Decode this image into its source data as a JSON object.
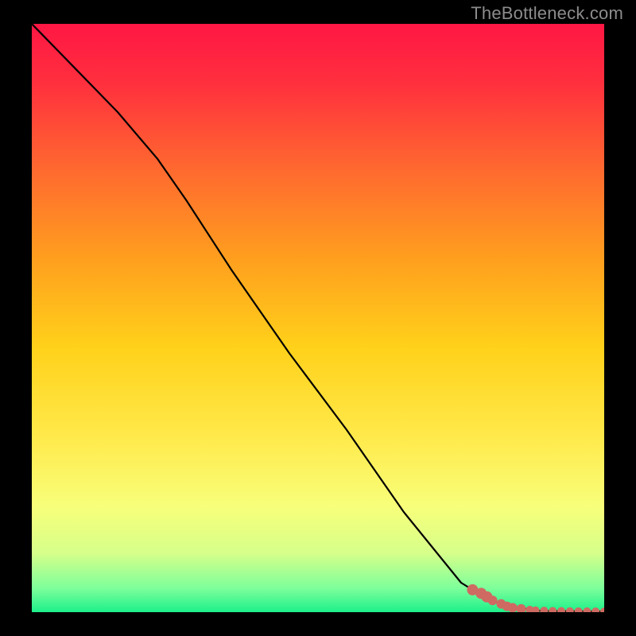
{
  "attribution": "TheBottleneck.com",
  "colors": {
    "background": "#000000",
    "attribution_text": "#8c8c8c",
    "line": "#000000",
    "marker": "#cf6a62",
    "gradient_stops": [
      {
        "offset": "0%",
        "color": "#ff1744"
      },
      {
        "offset": "10%",
        "color": "#ff2f3e"
      },
      {
        "offset": "25%",
        "color": "#ff6a2f"
      },
      {
        "offset": "40%",
        "color": "#ff9f1e"
      },
      {
        "offset": "55%",
        "color": "#ffd11a"
      },
      {
        "offset": "70%",
        "color": "#ffe94a"
      },
      {
        "offset": "82%",
        "color": "#f8ff7a"
      },
      {
        "offset": "90%",
        "color": "#d6ff8a"
      },
      {
        "offset": "96%",
        "color": "#7cff9b"
      },
      {
        "offset": "100%",
        "color": "#1cf08a"
      }
    ]
  },
  "chart_data": {
    "type": "line",
    "title": "",
    "xlabel": "",
    "ylabel": "",
    "xlim": [
      0,
      100
    ],
    "ylim": [
      0,
      100
    ],
    "series": [
      {
        "name": "curve",
        "x": [
          0,
          7,
          15,
          22,
          27,
          35,
          45,
          55,
          65,
          75,
          80,
          83,
          86,
          89,
          100
        ],
        "values": [
          100,
          93,
          85,
          77,
          70,
          58,
          44,
          31,
          17,
          5,
          2,
          1.2,
          0.6,
          0.2,
          0.1
        ]
      }
    ],
    "markers": {
      "name": "highlighted-points",
      "x": [
        77,
        78.5,
        79.5,
        80.5,
        82,
        83,
        84,
        85.5,
        87,
        88,
        89.5,
        91,
        92.5,
        94,
        95.5,
        97,
        98.5,
        100
      ],
      "values": [
        3.8,
        3.2,
        2.6,
        2.0,
        1.4,
        1.0,
        0.75,
        0.55,
        0.4,
        0.3,
        0.25,
        0.2,
        0.18,
        0.15,
        0.14,
        0.13,
        0.12,
        0.1
      ]
    }
  }
}
